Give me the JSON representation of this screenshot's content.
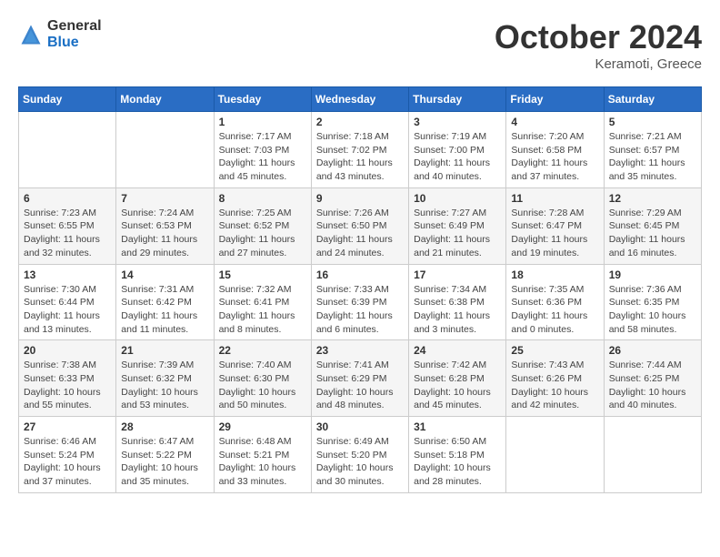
{
  "header": {
    "logo_general": "General",
    "logo_blue": "Blue",
    "month": "October 2024",
    "location": "Keramoti, Greece"
  },
  "weekdays": [
    "Sunday",
    "Monday",
    "Tuesday",
    "Wednesday",
    "Thursday",
    "Friday",
    "Saturday"
  ],
  "weeks": [
    [
      {
        "day": null,
        "info": null
      },
      {
        "day": null,
        "info": null
      },
      {
        "day": "1",
        "info": "Sunrise: 7:17 AM\nSunset: 7:03 PM\nDaylight: 11 hours and 45 minutes."
      },
      {
        "day": "2",
        "info": "Sunrise: 7:18 AM\nSunset: 7:02 PM\nDaylight: 11 hours and 43 minutes."
      },
      {
        "day": "3",
        "info": "Sunrise: 7:19 AM\nSunset: 7:00 PM\nDaylight: 11 hours and 40 minutes."
      },
      {
        "day": "4",
        "info": "Sunrise: 7:20 AM\nSunset: 6:58 PM\nDaylight: 11 hours and 37 minutes."
      },
      {
        "day": "5",
        "info": "Sunrise: 7:21 AM\nSunset: 6:57 PM\nDaylight: 11 hours and 35 minutes."
      }
    ],
    [
      {
        "day": "6",
        "info": "Sunrise: 7:23 AM\nSunset: 6:55 PM\nDaylight: 11 hours and 32 minutes."
      },
      {
        "day": "7",
        "info": "Sunrise: 7:24 AM\nSunset: 6:53 PM\nDaylight: 11 hours and 29 minutes."
      },
      {
        "day": "8",
        "info": "Sunrise: 7:25 AM\nSunset: 6:52 PM\nDaylight: 11 hours and 27 minutes."
      },
      {
        "day": "9",
        "info": "Sunrise: 7:26 AM\nSunset: 6:50 PM\nDaylight: 11 hours and 24 minutes."
      },
      {
        "day": "10",
        "info": "Sunrise: 7:27 AM\nSunset: 6:49 PM\nDaylight: 11 hours and 21 minutes."
      },
      {
        "day": "11",
        "info": "Sunrise: 7:28 AM\nSunset: 6:47 PM\nDaylight: 11 hours and 19 minutes."
      },
      {
        "day": "12",
        "info": "Sunrise: 7:29 AM\nSunset: 6:45 PM\nDaylight: 11 hours and 16 minutes."
      }
    ],
    [
      {
        "day": "13",
        "info": "Sunrise: 7:30 AM\nSunset: 6:44 PM\nDaylight: 11 hours and 13 minutes."
      },
      {
        "day": "14",
        "info": "Sunrise: 7:31 AM\nSunset: 6:42 PM\nDaylight: 11 hours and 11 minutes."
      },
      {
        "day": "15",
        "info": "Sunrise: 7:32 AM\nSunset: 6:41 PM\nDaylight: 11 hours and 8 minutes."
      },
      {
        "day": "16",
        "info": "Sunrise: 7:33 AM\nSunset: 6:39 PM\nDaylight: 11 hours and 6 minutes."
      },
      {
        "day": "17",
        "info": "Sunrise: 7:34 AM\nSunset: 6:38 PM\nDaylight: 11 hours and 3 minutes."
      },
      {
        "day": "18",
        "info": "Sunrise: 7:35 AM\nSunset: 6:36 PM\nDaylight: 11 hours and 0 minutes."
      },
      {
        "day": "19",
        "info": "Sunrise: 7:36 AM\nSunset: 6:35 PM\nDaylight: 10 hours and 58 minutes."
      }
    ],
    [
      {
        "day": "20",
        "info": "Sunrise: 7:38 AM\nSunset: 6:33 PM\nDaylight: 10 hours and 55 minutes."
      },
      {
        "day": "21",
        "info": "Sunrise: 7:39 AM\nSunset: 6:32 PM\nDaylight: 10 hours and 53 minutes."
      },
      {
        "day": "22",
        "info": "Sunrise: 7:40 AM\nSunset: 6:30 PM\nDaylight: 10 hours and 50 minutes."
      },
      {
        "day": "23",
        "info": "Sunrise: 7:41 AM\nSunset: 6:29 PM\nDaylight: 10 hours and 48 minutes."
      },
      {
        "day": "24",
        "info": "Sunrise: 7:42 AM\nSunset: 6:28 PM\nDaylight: 10 hours and 45 minutes."
      },
      {
        "day": "25",
        "info": "Sunrise: 7:43 AM\nSunset: 6:26 PM\nDaylight: 10 hours and 42 minutes."
      },
      {
        "day": "26",
        "info": "Sunrise: 7:44 AM\nSunset: 6:25 PM\nDaylight: 10 hours and 40 minutes."
      }
    ],
    [
      {
        "day": "27",
        "info": "Sunrise: 6:46 AM\nSunset: 5:24 PM\nDaylight: 10 hours and 37 minutes."
      },
      {
        "day": "28",
        "info": "Sunrise: 6:47 AM\nSunset: 5:22 PM\nDaylight: 10 hours and 35 minutes."
      },
      {
        "day": "29",
        "info": "Sunrise: 6:48 AM\nSunset: 5:21 PM\nDaylight: 10 hours and 33 minutes."
      },
      {
        "day": "30",
        "info": "Sunrise: 6:49 AM\nSunset: 5:20 PM\nDaylight: 10 hours and 30 minutes."
      },
      {
        "day": "31",
        "info": "Sunrise: 6:50 AM\nSunset: 5:18 PM\nDaylight: 10 hours and 28 minutes."
      },
      {
        "day": null,
        "info": null
      },
      {
        "day": null,
        "info": null
      }
    ]
  ]
}
